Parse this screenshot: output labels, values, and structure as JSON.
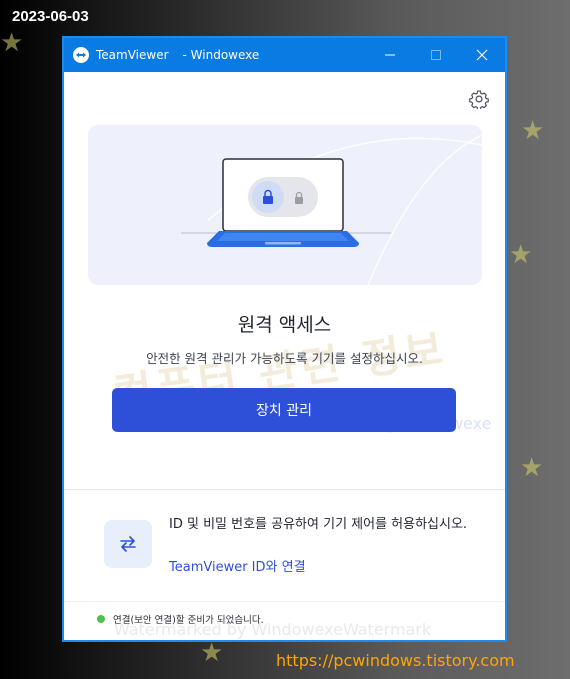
{
  "screenshot": {
    "date_stamp": "2023-06-03",
    "site_url": "https://pcwindows.tistory.com"
  },
  "window": {
    "app_name": "TeamViewer",
    "title_suffix": "- Windowexe",
    "controls": {
      "minimize": "—",
      "maximize": "☐",
      "close": "✕"
    },
    "accent_color": "#0a7be2"
  },
  "main": {
    "heading": "원격 액세스",
    "description": "안전한 원격 관리가 가능하도록 기기를 설정하십시오.",
    "primary_button": "장치 관리",
    "primary_color": "#2e4fd8"
  },
  "share": {
    "text": "ID 및 비밀 번호를 공유하여 기기 제어를 허용하십시오.",
    "link": "TeamViewer ID와 연결"
  },
  "status": {
    "text": "연결(보안 연결)할 준비가 되었습니다.",
    "color": "#4fc04a"
  },
  "watermarks": {
    "big": "컴퓨터 관련 정보",
    "small": "watermark by windowexe",
    "bottom": "Watermarked by WindowexeWatermark"
  },
  "icons": [
    "teamviewer-logo-icon",
    "gear-icon",
    "lock-icon",
    "swap-arrows-icon",
    "laptop-illustration"
  ]
}
